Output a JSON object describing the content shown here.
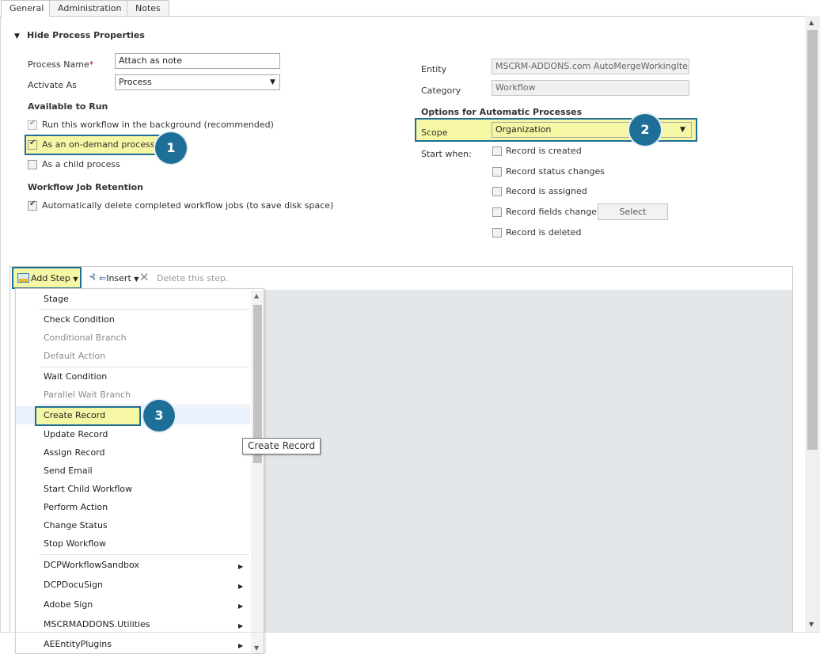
{
  "tabs": [
    "General",
    "Administration",
    "Notes"
  ],
  "section": {
    "title": "Hide Process Properties"
  },
  "form": {
    "process_name_label": "Process Name",
    "required_mark": "*",
    "process_name_value": "Attach as note",
    "activate_as_label": "Activate As",
    "activate_as_value": "Process",
    "available_heading": "Available to Run",
    "run_background_label": "Run this workflow in the background (recommended)",
    "on_demand_label": "As an on-demand process",
    "child_process_label": "As a child process",
    "retention_heading": "Workflow Job Retention",
    "auto_delete_label": "Automatically delete completed workflow jobs (to save disk space)",
    "entity_label": "Entity",
    "entity_value": "MSCRM-ADDONS.com AutoMergeWorkingItem",
    "category_label": "Category",
    "category_value": "Workflow",
    "options_heading": "Options for Automatic Processes",
    "scope_label": "Scope",
    "scope_value": "Organization",
    "start_when_label": "Start when:",
    "start_options": [
      "Record is created",
      "Record status changes",
      "Record is assigned",
      "Record fields change",
      "Record is deleted"
    ],
    "select_button": "Select"
  },
  "badges": [
    "1",
    "2",
    "3"
  ],
  "toolbar": {
    "add_step": "Add Step",
    "insert": "Insert",
    "delete": "Delete this step."
  },
  "menu": {
    "items": [
      "Stage",
      "Check Condition",
      "Conditional Branch",
      "Default Action",
      "Wait Condition",
      "Parallel Wait Branch",
      "Create Record",
      "Update Record",
      "Assign Record",
      "Send Email",
      "Start Child Workflow",
      "Perform Action",
      "Change Status",
      "Stop Workflow",
      "DCPWorkflowSandbox",
      "DCPDocuSign",
      "Adobe Sign",
      "MSCRMADDONS.Utilities",
      "AEEntityPlugins"
    ]
  },
  "tooltip": "Create Record",
  "colors": {
    "highlight": "#f6f7a5",
    "badge": "#1d6f98",
    "required": "#d0021b"
  }
}
